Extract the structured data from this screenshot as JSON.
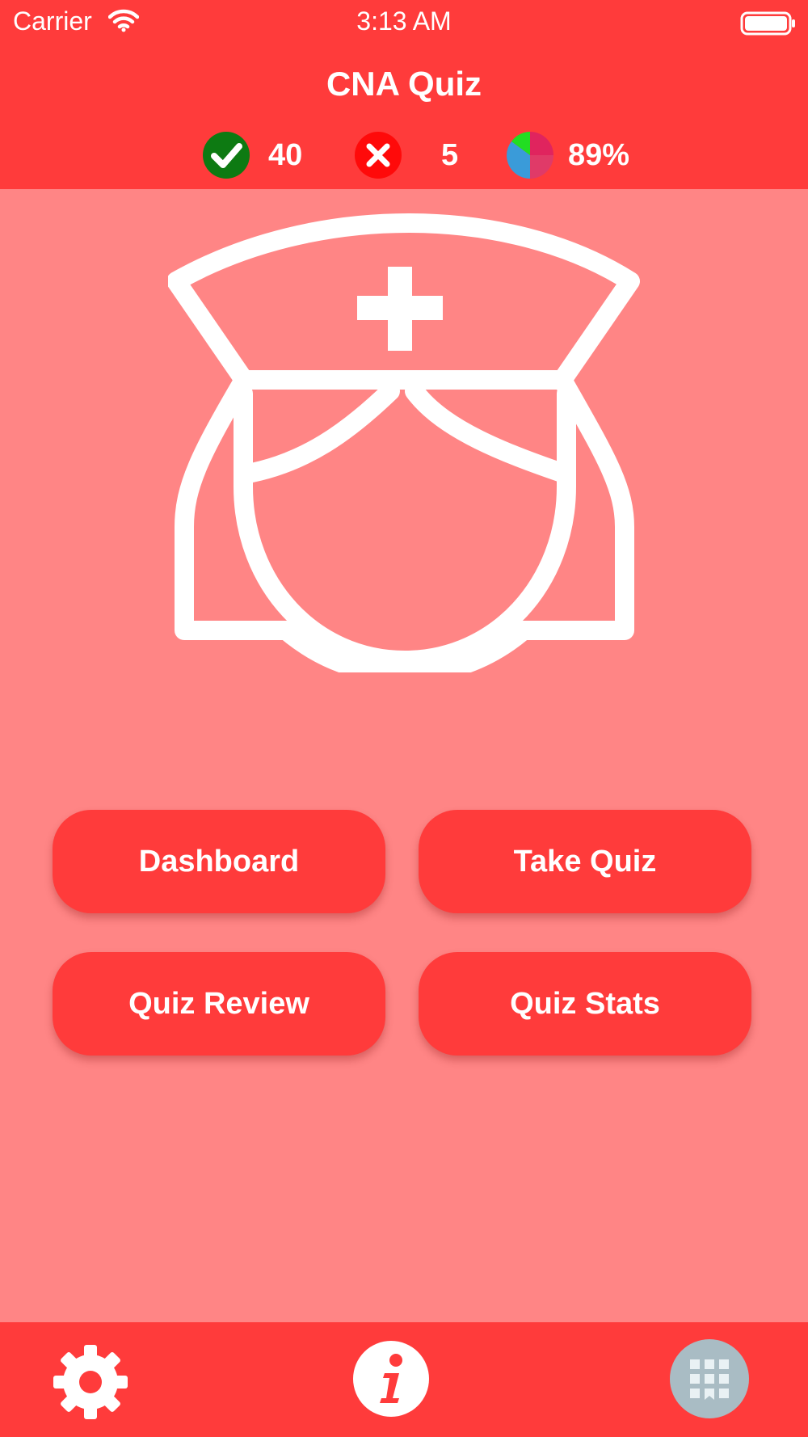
{
  "status_bar": {
    "carrier": "Carrier",
    "time": "3:13 AM",
    "icons": [
      "wifi-icon",
      "battery-icon"
    ]
  },
  "header": {
    "title": "CNA Quiz",
    "stats": {
      "correct": {
        "icon": "check-circle-icon",
        "value": "40",
        "color": "#0d7a12"
      },
      "wrong": {
        "icon": "x-circle-icon",
        "value": "5",
        "color": "#ff0a0a"
      },
      "score": {
        "icon": "pie-chart-icon",
        "value": "89%"
      }
    }
  },
  "illustration": {
    "icon": "nurse-icon"
  },
  "buttons": {
    "dashboard": "Dashboard",
    "take_quiz": "Take Quiz",
    "quiz_review": "Quiz Review",
    "quiz_stats": "Quiz Stats"
  },
  "tab_bar": {
    "icons": [
      "gear-icon",
      "info-icon",
      "apps-grid-icon"
    ]
  },
  "colors": {
    "primary": "#ff3b3b",
    "background": "#ff8585",
    "text": "#ffffff"
  }
}
